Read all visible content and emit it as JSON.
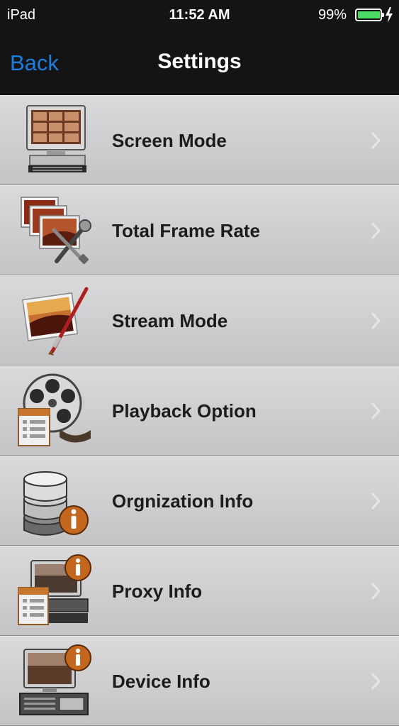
{
  "status_bar": {
    "carrier": "iPad",
    "time": "11:52 AM",
    "battery_percent": "99%",
    "battery_level": 0.99,
    "battery_color": "#4cd964"
  },
  "nav": {
    "back_label": "Back",
    "title": "Settings",
    "back_color": "#1a7fe0"
  },
  "settings_items": [
    {
      "label": "Screen Mode",
      "icon": "monitor-grid-icon"
    },
    {
      "label": "Total Frame Rate",
      "icon": "frames-tools-icon"
    },
    {
      "label": "Stream Mode",
      "icon": "picture-brush-icon"
    },
    {
      "label": "Playback Option",
      "icon": "film-reel-icon"
    },
    {
      "label": "Orgnization Info",
      "icon": "database-info-icon"
    },
    {
      "label": "Proxy Info",
      "icon": "proxy-info-icon"
    },
    {
      "label": "Device Info",
      "icon": "device-info-icon"
    }
  ]
}
